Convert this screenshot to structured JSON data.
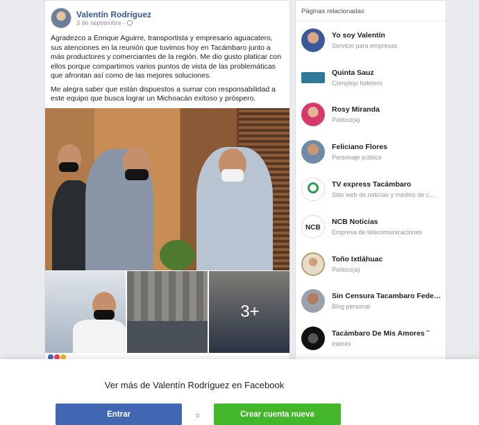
{
  "post": {
    "author": "Valentín Rodríguez",
    "date": "3 de septiembre ·",
    "paragraphs": [
      "Agradezco a Enrique Aguirre, transportista y empresario aguacatero, sus atenciones en la reunión que tuvimos hoy en Tacámbaro junto a más productores y comerciantes de la región. Me dio gusto platicar con ellos porque compartimos varios puntos de vista de las problemáticas que afrontan así como de las mejores soluciones.",
      "Me alegra saber que están dispuestos a sumar con responsabilidad a este equipo que busca lograr un Michoacán exitoso y próspero."
    ],
    "more_photos": "3+"
  },
  "related": {
    "title": "Páginas relacionadas",
    "pages": [
      {
        "name": "Yo soy Valentín",
        "category": "Servicio para empresas"
      },
      {
        "name": "Quinta Sauz",
        "category": "Complejo hotelero"
      },
      {
        "name": "Rosy Miranda",
        "category": "Político(a)"
      },
      {
        "name": "Feliciano Flores",
        "category": "Personaje público"
      },
      {
        "name": "TV express Tacámbaro",
        "category": "Sitio web de noticias y medios de c..."
      },
      {
        "name": "NCB Noticias",
        "category": "Empresa de telecomunicaciones"
      },
      {
        "name": "Toño Ixtláhuac",
        "category": "Político(a)"
      },
      {
        "name": "Sin Censura Tacambaro Federna...",
        "category": "Blog personal"
      },
      {
        "name": "Tacámbaro De Mis Amores ˜",
        "category": "Interés"
      }
    ]
  },
  "banner": {
    "text": "Ver más de Valentín Rodríguez en Facebook",
    "login_label": "Entrar",
    "or_label": "o",
    "create_label": "Crear cuenta nueva"
  },
  "colors": {
    "facebook_blue": "#4267b2",
    "create_green": "#42b72a",
    "link_blue": "#385898"
  }
}
